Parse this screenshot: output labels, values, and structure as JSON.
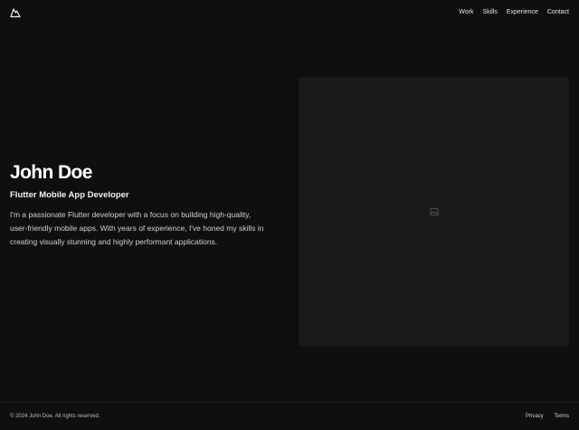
{
  "header": {
    "logo_icon": "mountain-logo-icon",
    "nav": [
      {
        "label": "Work"
      },
      {
        "label": "Skills"
      },
      {
        "label": "Experience"
      },
      {
        "label": "Contact"
      }
    ]
  },
  "hero": {
    "name": "John Doe",
    "role": "Flutter Mobile App Developer",
    "bio": "I'm a passionate Flutter developer with a focus on building high-quality, user-friendly mobile apps. With years of experience, I've honed my skills in creating visually stunning and highly performant applications."
  },
  "image_card": {
    "icon": "image-placeholder-icon"
  },
  "footer": {
    "copyright": "© 2024 John Doe. All rights reserved.",
    "links": [
      {
        "label": "Privacy"
      },
      {
        "label": "Terms"
      }
    ]
  },
  "colors": {
    "background": "#0f0f10",
    "card": "#1a1a1a",
    "text": "#ffffff"
  }
}
